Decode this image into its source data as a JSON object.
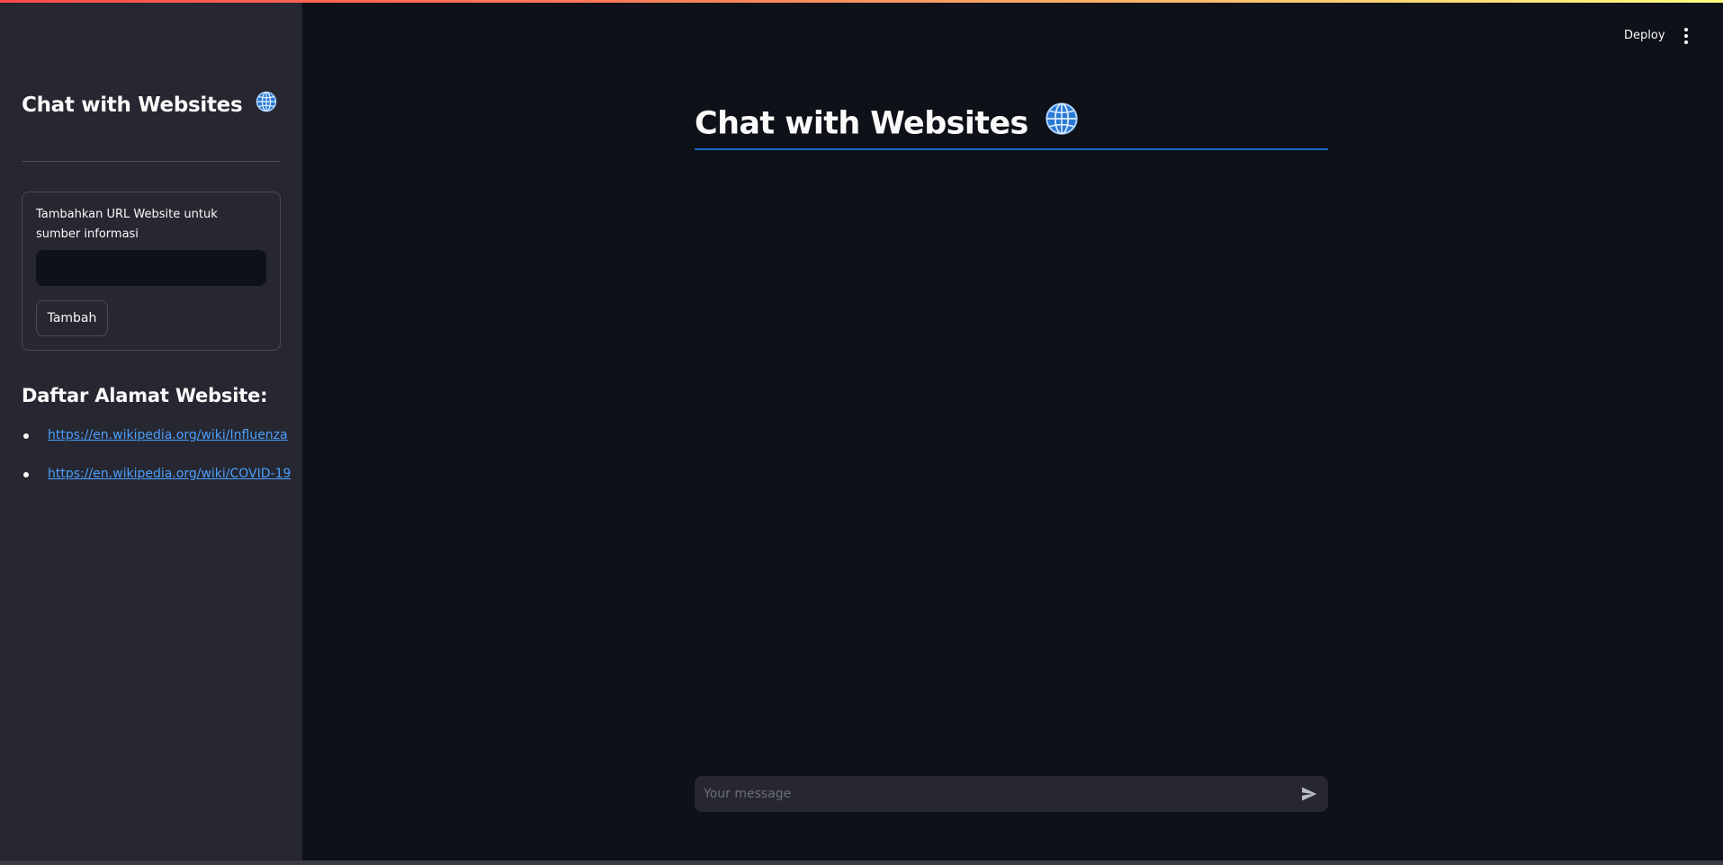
{
  "sidebar": {
    "title": "Chat with Websites",
    "title_icon": "globe-icon",
    "form": {
      "label": "Tambahkan URL Website untuk sumber informasi",
      "input_value": "",
      "button_label": "Tambah"
    },
    "list_title": "Daftar Alamat Website:",
    "urls": [
      "https://en.wikipedia.org/wiki/Influenza",
      "https://en.wikipedia.org/wiki/COVID-19"
    ]
  },
  "header": {
    "deploy_label": "Deploy",
    "menu_icon": "more-vertical-icon"
  },
  "main": {
    "title": "Chat with Websites",
    "title_icon": "globe-icon",
    "chat_input": {
      "placeholder": "Your message",
      "send_icon": "send-icon"
    }
  },
  "colors": {
    "background": "#0e1117",
    "sidebar": "#262730",
    "link": "#4b9fff",
    "title_rule": "#1c6bc7",
    "text": "#fafafa"
  }
}
